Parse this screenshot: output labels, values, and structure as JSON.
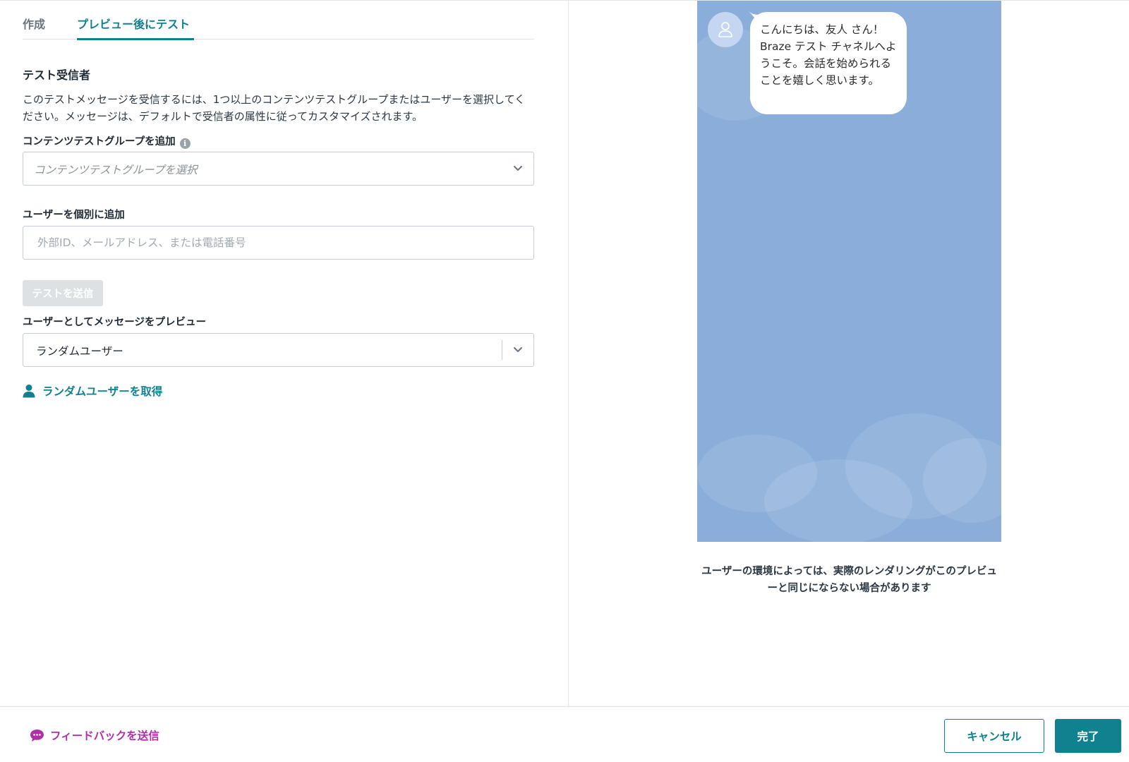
{
  "tabs": {
    "compose": "作成",
    "preview_test": "プレビュー後にテスト"
  },
  "test_recipients": {
    "title": "テスト受信者",
    "description": "このテストメッセージを受信するには、1つ以上のコンテンツテストグループまたはユーザーを選択してください。メッセージは、デフォルトで受信者の属性に従ってカスタマイズされます。",
    "group_label": "コンテンツテストグループを追加",
    "group_placeholder": "コンテンツテストグループを選択",
    "users_label": "ユーザーを個別に追加",
    "users_placeholder": "外部ID、メールアドレス、または電話番号",
    "send_test_label": "テストを送信"
  },
  "preview_as": {
    "label": "ユーザーとしてメッセージをプレビュー",
    "selected_value": "ランダムユーザー",
    "random_user_link": "ランダムユーザーを取得"
  },
  "preview": {
    "message": "こんにちは、友人 さん！Braze テスト チャネルへようこそ。会話を始められることを嬉しく思います。",
    "note": "ユーザーの環境によっては、実際のレンダリングがこのプレビューと同じにならない場合があります",
    "background_color": "#8badda"
  },
  "footer": {
    "feedback_label": "フィードバックを送信",
    "cancel_label": "キャンセル",
    "done_label": "完了"
  },
  "colors": {
    "accent": "#10818f",
    "feedback": "#b02fa8"
  },
  "icons": {
    "info": "info-icon",
    "chevron": "chevron-down-icon",
    "user": "user-icon",
    "avatar": "avatar-icon",
    "feedback": "chat-bubble-icon"
  }
}
